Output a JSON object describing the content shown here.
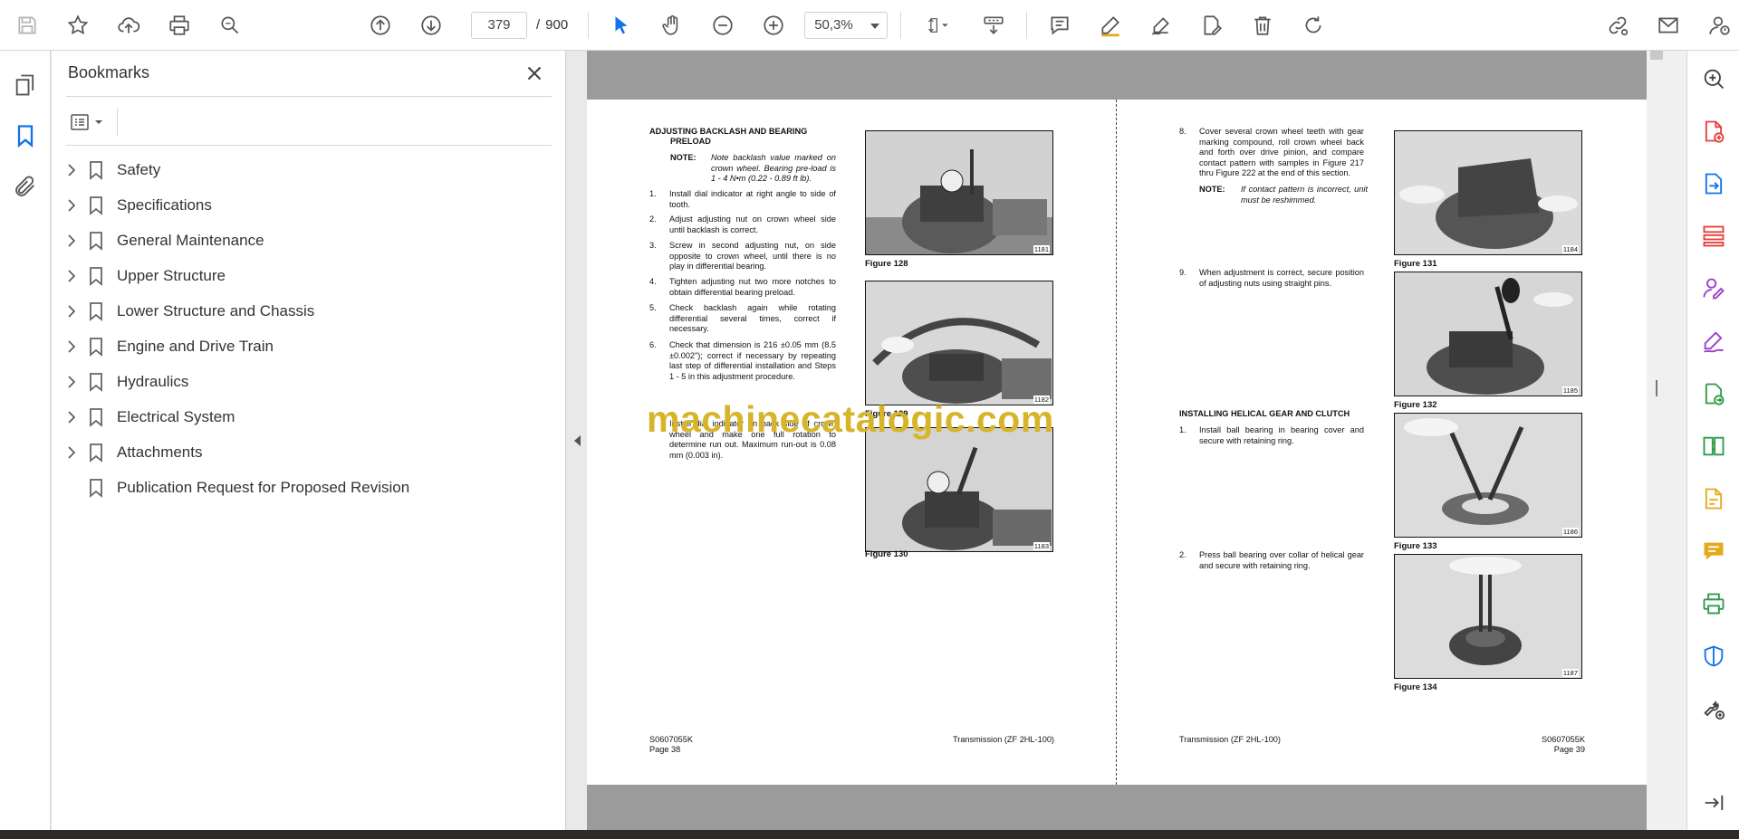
{
  "toolbar": {
    "current_page": "379",
    "page_separator": "/",
    "total_pages": "900",
    "zoom": "50,3%"
  },
  "bookmarks": {
    "title": "Bookmarks",
    "items": [
      {
        "label": "Safety"
      },
      {
        "label": "Specifications"
      },
      {
        "label": "General Maintenance"
      },
      {
        "label": "Upper Structure"
      },
      {
        "label": "Lower Structure and Chassis"
      },
      {
        "label": "Engine and Drive Train"
      },
      {
        "label": "Hydraulics"
      },
      {
        "label": "Electrical System"
      },
      {
        "label": "Attachments"
      },
      {
        "label": "Publication Request for Proposed Revision"
      }
    ]
  },
  "left_page": {
    "heading_line1": "ADJUSTING BACKLASH AND BEARING",
    "heading_line2": "PRELOAD",
    "note_label": "NOTE:",
    "note_text": "Note backlash value marked on crown wheel. Bearing pre-load is 1 - 4 N•m (0.22 - 0.89 ft lb).",
    "steps": [
      {
        "num": "1.",
        "text": "Install dial indicator at right angle to side of tooth."
      },
      {
        "num": "2.",
        "text": "Adjust adjusting nut on crown wheel side until backlash is correct."
      },
      {
        "num": "3.",
        "text": "Screw in second adjusting nut, on side opposite to crown wheel, until there is no play in differential bearing."
      },
      {
        "num": "4.",
        "text": "Tighten adjusting nut two more notches to obtain differential bearing preload."
      },
      {
        "num": "5.",
        "text": "Check backlash again while rotating differential several times, correct if necessary."
      },
      {
        "num": "6.",
        "text": "Check that dimension is 216 ±0.05 mm (8.5 ±0.002\"); correct if necessary by repeating last step of differential installation and Steps 1 - 5 in this adjustment procedure."
      },
      {
        "num": "7.",
        "text": "Install dial indicator on back side of crown wheel and make one full rotation to determine run out. Maximum run-out is 0.08 mm (0.003 in)."
      }
    ],
    "figures": [
      {
        "caption": "Figure 128",
        "number": "1181"
      },
      {
        "caption": "Figure 129",
        "number": "1182"
      },
      {
        "caption": "Figure 130",
        "number": "1183"
      }
    ],
    "footer_code": "S0607055K",
    "footer_page": "Page 38",
    "footer_title": "Transmission (ZF 2HL-100)"
  },
  "right_page": {
    "step8_num": "8.",
    "step8_text": "Cover several crown wheel teeth with gear marking compound, roll crown wheel back and forth over drive pinion, and compare contact pattern with samples in Figure 217 thru Figure 222 at the end of this section.",
    "note_label": "NOTE:",
    "note_text": "If contact pattern is incorrect, unit must be reshimmed.",
    "step9_num": "9.",
    "step9_text": "When adjustment is correct, secure position of adjusting nuts using straight pins.",
    "heading": "INSTALLING HELICAL GEAR AND CLUTCH",
    "steps": [
      {
        "num": "1.",
        "text": "Install ball bearing in bearing cover and secure with retaining ring."
      },
      {
        "num": "2.",
        "text": "Press ball bearing over collar of helical gear and secure with retaining ring."
      }
    ],
    "figures": [
      {
        "caption": "Figure 131",
        "number": "1184"
      },
      {
        "caption": "Figure 132",
        "number": "1185"
      },
      {
        "caption": "Figure 133",
        "number": "1186"
      },
      {
        "caption": "Figure 134",
        "number": "1187"
      }
    ],
    "footer_title": "Transmission (ZF 2HL-100)",
    "footer_code": "S0607055K",
    "footer_page": "Page 39"
  },
  "watermark": "machinecatalogic.com",
  "colors": {
    "accent_blue": "#1473e6",
    "pdf_red": "#e3413b",
    "purple": "#9b3ec8",
    "green": "#2e9a4a",
    "yellow": "#e4a91c",
    "watermark": "#d8b42a"
  }
}
